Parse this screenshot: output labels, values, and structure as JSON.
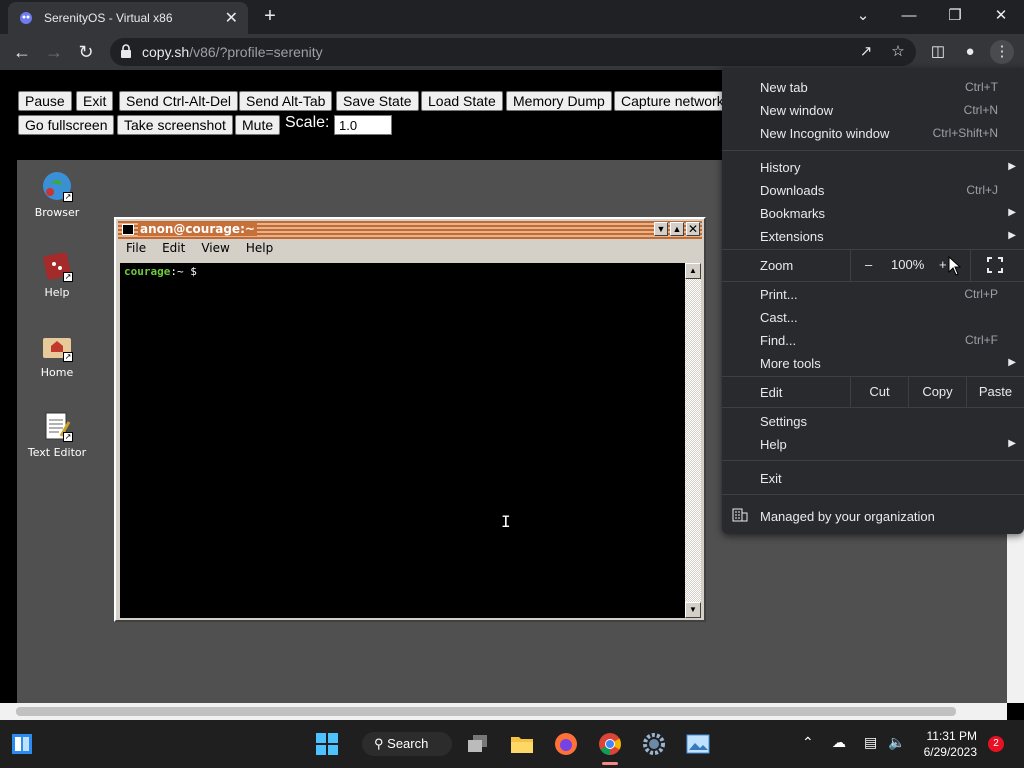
{
  "browser": {
    "tab_title": "SerenityOS - Virtual x86",
    "tab_close": "✕",
    "new_tab": "+",
    "url_host": "copy.sh",
    "url_path": "/v86/?profile=serenity",
    "window_min": "—",
    "window_restore": "❐",
    "window_close": "✕",
    "tab_search": "⌄"
  },
  "v86": {
    "buttons_row1": [
      "Pause",
      "Exit",
      "Send Ctrl-Alt-Del",
      "Send Alt-Tab",
      "Save State",
      "Load State",
      "Memory Dump",
      "Capture network"
    ],
    "buttons_row2": [
      "Go fullscreen",
      "Take screenshot",
      "Mute"
    ],
    "scale_label": "Scale:",
    "scale_value": "1.0"
  },
  "desktop": {
    "icons": [
      {
        "label": "Browser",
        "icon": "globe-icon"
      },
      {
        "label": "Help",
        "icon": "book-icon"
      },
      {
        "label": "Home",
        "icon": "folder-home-icon"
      },
      {
        "label": "Text Editor",
        "icon": "notepad-icon"
      }
    ]
  },
  "terminal": {
    "title": "anon@courage:~",
    "menu": [
      "File",
      "Edit",
      "View",
      "Help"
    ],
    "prompt_host": "courage",
    "prompt_rest": ":~ $"
  },
  "chrome_menu": {
    "new_tab": "New tab",
    "new_tab_sc": "Ctrl+T",
    "new_window": "New window",
    "new_window_sc": "Ctrl+N",
    "new_incognito": "New Incognito window",
    "new_incognito_sc": "Ctrl+Shift+N",
    "history": "History",
    "downloads": "Downloads",
    "downloads_sc": "Ctrl+J",
    "bookmarks": "Bookmarks",
    "extensions": "Extensions",
    "zoom": "Zoom",
    "zoom_minus": "–",
    "zoom_value": "100%",
    "zoom_plus": "+",
    "print": "Print...",
    "print_sc": "Ctrl+P",
    "cast": "Cast...",
    "find": "Find...",
    "find_sc": "Ctrl+F",
    "more_tools": "More tools",
    "edit": "Edit",
    "cut": "Cut",
    "copy": "Copy",
    "paste": "Paste",
    "settings": "Settings",
    "help": "Help",
    "exit": "Exit",
    "managed": "Managed by your organization"
  },
  "taskbar": {
    "search_label": "Search",
    "time": "11:31 PM",
    "date": "6/29/2023",
    "notification_count": "2"
  }
}
